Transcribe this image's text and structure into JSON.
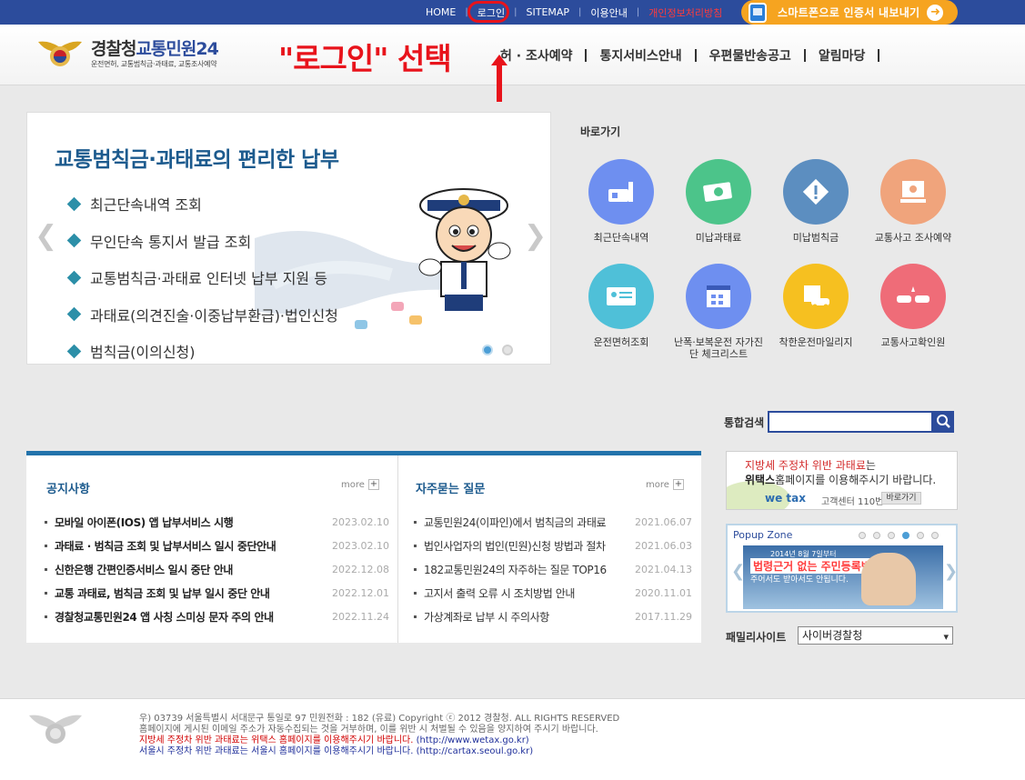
{
  "topbar": {
    "links": [
      "HOME",
      "로그인",
      "SITEMAP",
      "이용안내",
      "개인정보처리방침"
    ],
    "smart_button": "스마트폰으로 인증서 내보내기",
    "smart_arrow": "➜"
  },
  "header": {
    "logo_prefix": "경찰청",
    "logo_main": "교통민원24",
    "logo_sub": "운전면허, 교통범칙금·과태료, 교통조사예약",
    "annotation": "\"로그인\" 선택",
    "nav": [
      "조사예약",
      "통지서비스안내",
      "우편물반송공고",
      "알림마당"
    ],
    "nav_first_fragment": "허 · "
  },
  "slider": {
    "title": "교통범칙금·과태료의 편리한 납부",
    "items": [
      "최근단속내역 조회",
      "무인단속 통지서 발급 조회",
      "교통범칙금·과태료 인터넷 납부 지원 등",
      "과태료(의견진술·이중납부환급)·법인신청",
      "범칙금(이의신청)"
    ],
    "prev": "❮",
    "next": "❯"
  },
  "quick": {
    "title": "바로가기",
    "items": [
      {
        "label": "최근단속내역",
        "icon": "camera-icon",
        "color": "#6e8ff0"
      },
      {
        "label": "미납과태료",
        "icon": "money-icon",
        "color": "#4cc48a"
      },
      {
        "label": "미납범칙금",
        "icon": "warning-icon",
        "color": "#5c8ec0"
      },
      {
        "label": "교통사고 조사예약",
        "icon": "monitor-icon",
        "color": "#f0a47c"
      },
      {
        "label": "운전면허조회",
        "icon": "license-icon",
        "color": "#4fc0d8"
      },
      {
        "label": "난폭·보복운전 자가진단 체크리스트",
        "icon": "checklist-icon",
        "color": "#6e8ff0"
      },
      {
        "label": "착한운전마일리지",
        "icon": "mileage-icon",
        "color": "#f6c020"
      },
      {
        "label": "교통사고확인원",
        "icon": "crash-icon",
        "color": "#ef6c78"
      }
    ]
  },
  "search": {
    "label": "통합검색",
    "placeholder": ""
  },
  "notice": {
    "title": "공지사항",
    "more": "more",
    "rows": [
      {
        "title": "모바일 아이폰(IOS) 앱 납부서비스 시행",
        "date": "2023.02.10"
      },
      {
        "title": "과태료 · 범칙금 조회 및 납부서비스 일시 중단안내",
        "date": "2023.02.10"
      },
      {
        "title": "신한은행 간편인증서비스 일시 중단 안내",
        "date": "2022.12.08"
      },
      {
        "title": "교통 과태료, 범칙금 조회 및 납부 일시 중단 안내",
        "date": "2022.12.01"
      },
      {
        "title": "경찰청교통민원24 앱 사칭 스미싱 문자 주의 안내",
        "date": "2022.11.24"
      }
    ]
  },
  "faq": {
    "title": "자주묻는 질문",
    "more": "more",
    "rows": [
      {
        "title": "교통민원24(이파인)에서 범칙금의 과태료",
        "date": "2021.06.07"
      },
      {
        "title": "법인사업자의 법인(민원)신청 방법과 절차",
        "date": "2021.06.03"
      },
      {
        "title": "182교통민원24의 자주하는 질문 TOP16",
        "date": "2021.04.13"
      },
      {
        "title": "고지서 출력 오류 시 조치방법 안내",
        "date": "2020.11.01"
      },
      {
        "title": "가상계좌로 납부 시 주의사항",
        "date": "2017.11.29"
      }
    ]
  },
  "wetax": {
    "line1_red": "지방세 주정차 위반 과태료",
    "line1_rest": "는",
    "line2_bold": "위택스",
    "line2_rest": "홈페이지를 이용해주시기 바랍니다.",
    "logo": "we tax",
    "center": "고객센터 110번",
    "button": "바로가기"
  },
  "popup": {
    "title": "Popup Zone",
    "line1": "2014년 8월 7일부터",
    "line2": "법령근거 없는 주민등록번호",
    "line3": "주어서도 받아서도 안됩니다."
  },
  "family": {
    "label": "패밀리사이트",
    "selected": "사이버경찰청"
  },
  "footer": {
    "line1": "우) 03739 서울특별시 서대문구 통일로 97  민원전화 : 182 (유료)          Copyright ⓒ 2012 경찰청. ALL RIGHTS RESERVED",
    "line2": "홈페이지에 게시된 이메일 주소가 자동수집되는 것을 거부하며, 이를 위반 시 처벌될 수 있음을 양지하여 주시기 바랍니다.",
    "line3": "지방세 주정차 위반 과태료는 위택스 홈페이지를 이용해주시기 바랍니다.",
    "line3_url": "(http://www.wetax.go.kr)",
    "line4": "서울시 주정차 위반 과태료는 서울시 홈페이지를 이용해주시기 바랍니다.",
    "line4_url": "(http://cartax.seoul.go.kr)"
  }
}
